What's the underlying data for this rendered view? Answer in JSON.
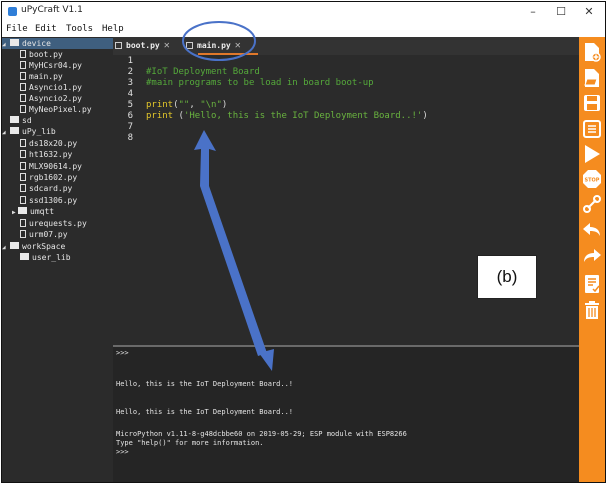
{
  "window": {
    "title": "uPyCraft V1.1",
    "controls": {
      "minimize": "–",
      "maximize": "☐",
      "close": "✕"
    }
  },
  "menubar": {
    "items": [
      "File",
      "Edit",
      "Tools",
      "Help"
    ]
  },
  "sidebar": {
    "items": [
      {
        "label": "device",
        "type": "folder",
        "expanded": true
      },
      {
        "label": "boot.py",
        "type": "file"
      },
      {
        "label": "MyHCsr04.py",
        "type": "file"
      },
      {
        "label": "main.py",
        "type": "file"
      },
      {
        "label": "Asyncio1.py",
        "type": "file"
      },
      {
        "label": "Asyncio2.py",
        "type": "file"
      },
      {
        "label": "MyNeoPixel.py",
        "type": "file"
      },
      {
        "label": "sd",
        "type": "folder",
        "expanded": false
      },
      {
        "label": "uPy_lib",
        "type": "folder",
        "expanded": true
      },
      {
        "label": "ds18x20.py",
        "type": "file"
      },
      {
        "label": "ht1632.py",
        "type": "file"
      },
      {
        "label": "MLX90614.py",
        "type": "file"
      },
      {
        "label": "rgb1602.py",
        "type": "file"
      },
      {
        "label": "sdcard.py",
        "type": "file"
      },
      {
        "label": "ssd1306.py",
        "type": "file"
      },
      {
        "label": "umqtt",
        "type": "folder",
        "expanded": false
      },
      {
        "label": "urequests.py",
        "type": "file"
      },
      {
        "label": "urm07.py",
        "type": "file"
      },
      {
        "label": "workSpace",
        "type": "folder",
        "expanded": true
      },
      {
        "label": "user_lib",
        "type": "folder",
        "expanded": false
      }
    ]
  },
  "tabs": [
    {
      "label": "boot.py",
      "active": false
    },
    {
      "label": "main.py",
      "active": true
    }
  ],
  "editor": {
    "line_numbers": [
      "1",
      "2",
      "3",
      "4",
      "5",
      "6",
      "7",
      "8"
    ],
    "lines": {
      "l2": "#IoT Deployment Board",
      "l3": "#main programs to be load in board boot-up",
      "l5_kw": "print",
      "l5_a": "(",
      "l5_s1": "\"\"",
      "l5_c": ", ",
      "l5_s2": "\"\\n\"",
      "l5_b": ")",
      "l6_kw": "print",
      "l6_a": " (",
      "l6_s": "'Hello, this is the IoT Deployment Board..!'",
      "l6_b": ")"
    }
  },
  "terminal": {
    "lines": [
      ">>>",
      "Hello, this is the IoT Deployment Board..!",
      "Hello, this is the IoT Deployment Board..!",
      "MicroPython v1.11-8-g48dcbbe60 on 2019-05-29; ESP module with ESP8266",
      "Type \"help()\" for more information.",
      ">>>"
    ]
  },
  "toolbar": {
    "icons": [
      "new-file-icon",
      "open-file-icon",
      "save-icon",
      "download-run-icon",
      "stop-icon",
      "connect-icon",
      "undo-icon",
      "redo-icon",
      "syntax-check-icon",
      "clear-icon"
    ],
    "accent": "#f58c1f"
  },
  "annotation": {
    "label": "(b)",
    "color": "#4a72c8"
  }
}
